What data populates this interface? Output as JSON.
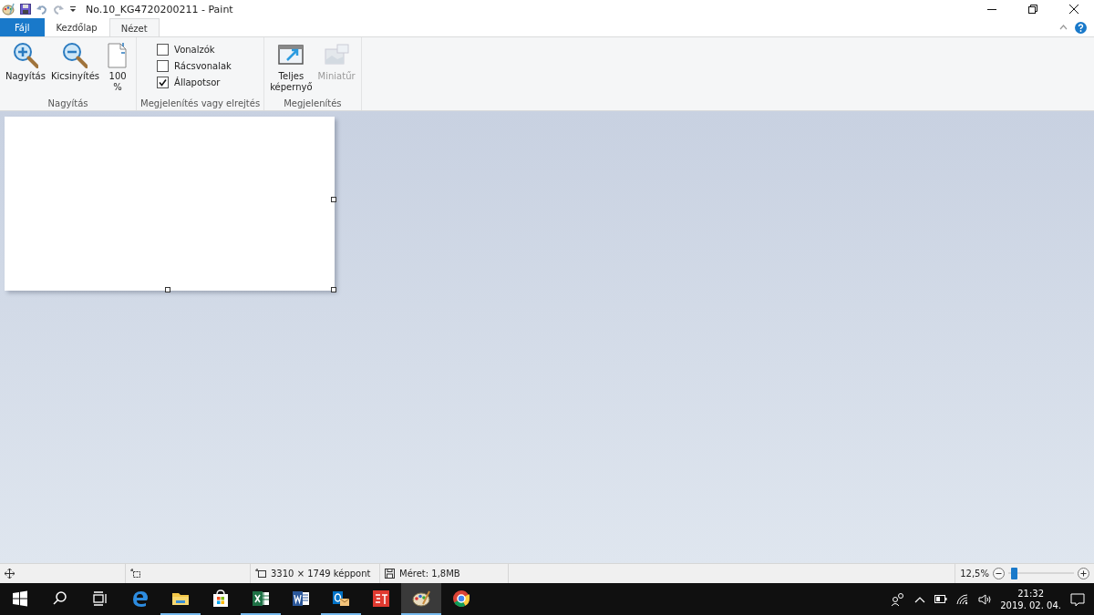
{
  "window": {
    "title": "No.10_KG4720200211 - Paint"
  },
  "tabs": [
    {
      "label": "Fájl",
      "kind": "file",
      "selected": false
    },
    {
      "label": "Kezdőlap",
      "kind": "tab",
      "selected": false
    },
    {
      "label": "Nézet",
      "kind": "tab",
      "selected": true
    }
  ],
  "ribbon": {
    "groups": [
      {
        "label": "Nagyítás",
        "items": [
          {
            "kind": "zoom-in",
            "label": "Nagyítás"
          },
          {
            "kind": "zoom-out",
            "label": "Kicsinyítés"
          },
          {
            "kind": "actual-size",
            "label": "100\n%"
          }
        ]
      },
      {
        "label": "Megjelenítés vagy elrejtés",
        "checkboxes": [
          {
            "label": "Vonalzók",
            "checked": false
          },
          {
            "label": "Rácsvonalak",
            "checked": false
          },
          {
            "label": "Állapotsor",
            "checked": true
          }
        ]
      },
      {
        "label": "Megjelenítés",
        "items": [
          {
            "kind": "fullscreen",
            "label": "Teljes\nképernyő",
            "disabled": false
          },
          {
            "kind": "thumbnail",
            "label": "Miniatűr",
            "disabled": true
          }
        ]
      }
    ]
  },
  "status_bar": {
    "dimensions": "3310 × 1749 képpont",
    "size": "Méret: 1,8MB",
    "zoom": "12,5%",
    "zoom_slider": {
      "level": 0.08
    }
  },
  "taskbar": {
    "apps": [
      {
        "kind": "edge",
        "running": false,
        "selected": false
      },
      {
        "kind": "explorer",
        "running": true,
        "selected": false
      },
      {
        "kind": "store",
        "running": false,
        "selected": false
      },
      {
        "kind": "excel",
        "running": true,
        "selected": false
      },
      {
        "kind": "word",
        "running": false,
        "selected": false
      },
      {
        "kind": "outlook",
        "running": true,
        "selected": false
      },
      {
        "kind": "st",
        "running": false,
        "selected": false
      },
      {
        "kind": "paint",
        "running": true,
        "selected": true
      },
      {
        "kind": "chrome",
        "running": false,
        "selected": false
      }
    ],
    "time": "21:32",
    "date": "2019. 02. 04."
  }
}
